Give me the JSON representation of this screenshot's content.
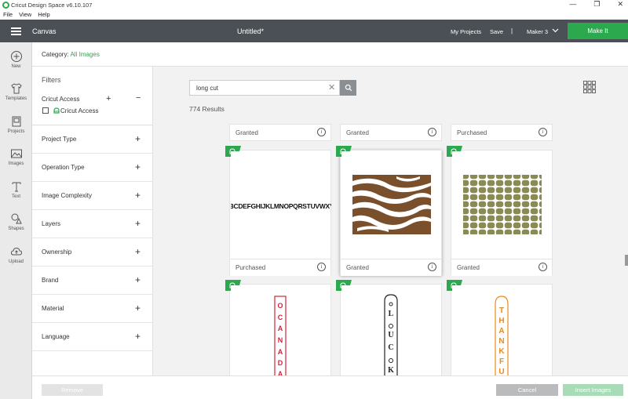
{
  "window": {
    "title": "Cricut Design Space  v6.10.107",
    "controls": [
      "—",
      "❐",
      "✕"
    ]
  },
  "menu": [
    "File",
    "View",
    "Help"
  ],
  "header": {
    "canvas": "Canvas",
    "doc_title": "Untitled*",
    "my_projects": "My Projects",
    "save": "Save",
    "divider": "|",
    "machine": "Maker 3",
    "make_it": "Make It"
  },
  "tools": [
    {
      "label": "New",
      "icon": "plus-circle-icon"
    },
    {
      "label": "Templates",
      "icon": "shirt-icon"
    },
    {
      "label": "Projects",
      "icon": "projects-icon"
    },
    {
      "label": "Images",
      "icon": "image-icon"
    },
    {
      "label": "Text",
      "icon": "text-icon"
    },
    {
      "label": "Shapes",
      "icon": "shapes-icon"
    },
    {
      "label": "Upload",
      "icon": "upload-icon"
    }
  ],
  "category": {
    "label": "Category:",
    "value": "All Images"
  },
  "filters": {
    "heading": "Filters",
    "access_title": "Cricut Access",
    "access_option": "Cricut Access",
    "rows": [
      "Project Type",
      "Operation Type",
      "Image Complexity",
      "Layers",
      "Ownership",
      "Brand",
      "Material",
      "Language"
    ]
  },
  "search": {
    "value": "long cut",
    "results": "774 Results"
  },
  "status_row": [
    "Granted",
    "Granted",
    "Purchased"
  ],
  "cards": [
    {
      "status": "Purchased",
      "art": "ALPHABET",
      "art_text": "ABCDEFGHIJKLMNOPQRSTUVWXYZ"
    },
    {
      "status": "Granted",
      "art": "ZEBRA"
    },
    {
      "status": "Granted",
      "art": "CROC"
    }
  ],
  "vertical_words": [
    {
      "text": "OCANADA",
      "color": "#d0243a"
    },
    {
      "text": "LUCKY",
      "color": "#222222"
    },
    {
      "text": "THANKFUL",
      "color": "#e88a1a"
    }
  ],
  "lucky_letters": [
    "L",
    "U",
    "C",
    "K",
    "Y"
  ],
  "bottom": {
    "remove": "Remove",
    "cancel": "Cancel",
    "insert": "Insert Images"
  },
  "colors": {
    "accent": "#2ca84f",
    "header": "#4a5055"
  }
}
